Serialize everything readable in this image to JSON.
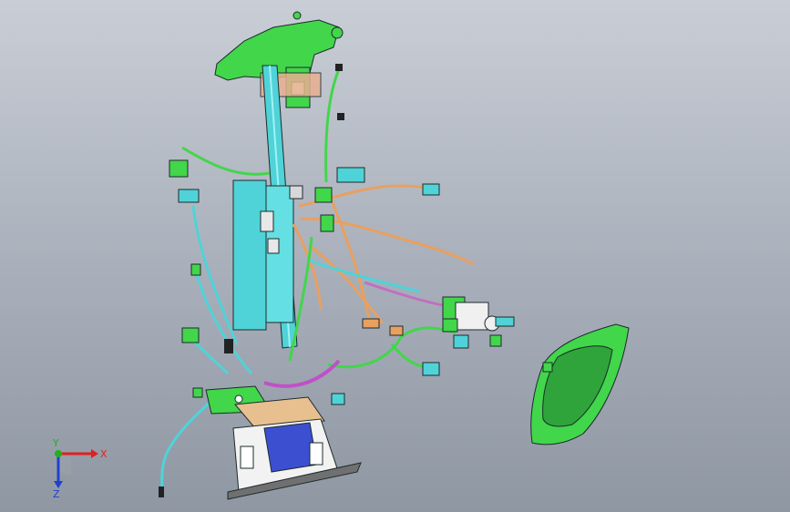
{
  "viewport": {
    "scene": "wire-harness-assembly-isometric",
    "background_top": "#c9ced6",
    "background_bottom": "#8f97a3"
  },
  "colors": {
    "harness_cyan": "#4fd3d8",
    "connector_green": "#42d64b",
    "wire_orange": "#e8a060",
    "wire_magenta": "#c050c8",
    "housing_blue": "#3c4fd0",
    "bracket_white": "#f2f2f2",
    "outline": "#1c2b2b"
  },
  "triad": {
    "x_label": "X",
    "y_label": "Y",
    "z_label": "Z",
    "x_color": "#e02020",
    "y_color": "#20b020",
    "z_color": "#2040d0"
  }
}
